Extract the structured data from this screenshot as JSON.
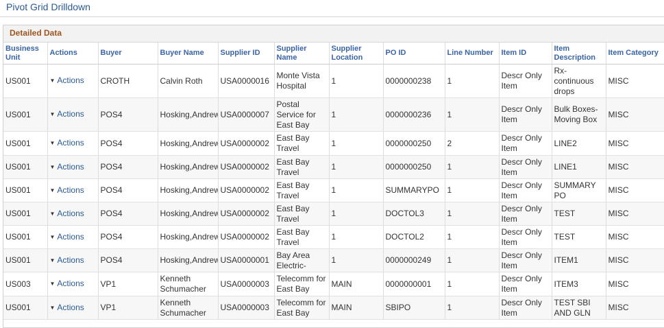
{
  "page": {
    "title": "Pivot Grid Drilldown"
  },
  "panel": {
    "title": "Detailed Data"
  },
  "columns": [
    "Business Unit",
    "Actions",
    "Buyer",
    "Buyer Name",
    "Supplier ID",
    "Supplier Name",
    "Supplier Location",
    "PO ID",
    "Line Number",
    "Item ID",
    "Item Description",
    "Item Category"
  ],
  "rows": [
    {
      "bu": "US001",
      "actions": "Actions",
      "buyer": "CROTH",
      "buyer_name": "Calvin Roth",
      "supplier_id": "USA0000016",
      "supplier_name": "Monte Vista Hospital",
      "supplier_location": "1",
      "po_id": "0000000238",
      "line": "1",
      "item_id": "Descr Only Item",
      "item_desc": "Rx-continuous drops",
      "item_cat": "MISC"
    },
    {
      "bu": "US001",
      "actions": "Actions",
      "buyer": "POS4",
      "buyer_name": "Hosking,Andrew",
      "supplier_id": "USA0000007",
      "supplier_name": "Postal Service for East Bay",
      "supplier_location": "1",
      "po_id": "0000000236",
      "line": "1",
      "item_id": "Descr Only Item",
      "item_desc": "Bulk Boxes-Moving Box",
      "item_cat": "MISC"
    },
    {
      "bu": "US001",
      "actions": "Actions",
      "buyer": "POS4",
      "buyer_name": "Hosking,Andrew",
      "supplier_id": "USA0000002",
      "supplier_name": "East Bay Travel",
      "supplier_location": "1",
      "po_id": "0000000250",
      "line": "2",
      "item_id": "Descr Only Item",
      "item_desc": "LINE2",
      "item_cat": "MISC"
    },
    {
      "bu": "US001",
      "actions": "Actions",
      "buyer": "POS4",
      "buyer_name": "Hosking,Andrew",
      "supplier_id": "USA0000002",
      "supplier_name": "East Bay Travel",
      "supplier_location": "1",
      "po_id": "0000000250",
      "line": "1",
      "item_id": "Descr Only Item",
      "item_desc": "LINE1",
      "item_cat": "MISC"
    },
    {
      "bu": "US001",
      "actions": "Actions",
      "buyer": "POS4",
      "buyer_name": "Hosking,Andrew",
      "supplier_id": "USA0000002",
      "supplier_name": "East Bay Travel",
      "supplier_location": "1",
      "po_id": "SUMMARYPO",
      "line": "1",
      "item_id": "Descr Only Item",
      "item_desc": "SUMMARY PO",
      "item_cat": "MISC"
    },
    {
      "bu": "US001",
      "actions": "Actions",
      "buyer": "POS4",
      "buyer_name": "Hosking,Andrew",
      "supplier_id": "USA0000002",
      "supplier_name": "East Bay Travel",
      "supplier_location": "1",
      "po_id": "DOCTOL3",
      "line": "1",
      "item_id": "Descr Only Item",
      "item_desc": "TEST",
      "item_cat": "MISC"
    },
    {
      "bu": "US001",
      "actions": "Actions",
      "buyer": "POS4",
      "buyer_name": "Hosking,Andrew",
      "supplier_id": "USA0000002",
      "supplier_name": "East Bay Travel",
      "supplier_location": "1",
      "po_id": "DOCTOL2",
      "line": "1",
      "item_id": "Descr Only Item",
      "item_desc": "TEST",
      "item_cat": "MISC"
    },
    {
      "bu": "US001",
      "actions": "Actions",
      "buyer": "POS4",
      "buyer_name": "Hosking,Andrew",
      "supplier_id": "USA0000001",
      "supplier_name": "Bay Area Electric-",
      "supplier_location": "1",
      "po_id": "0000000249",
      "line": "1",
      "item_id": "Descr Only Item",
      "item_desc": "ITEM1",
      "item_cat": "MISC"
    },
    {
      "bu": "US003",
      "actions": "Actions",
      "buyer": "VP1",
      "buyer_name": "Kenneth Schumacher",
      "supplier_id": "USA0000003",
      "supplier_name": "Telecomm for East Bay",
      "supplier_location": "MAIN",
      "po_id": "0000000001",
      "line": "1",
      "item_id": "Descr Only Item",
      "item_desc": "ITEM3",
      "item_cat": "MISC"
    },
    {
      "bu": "US001",
      "actions": "Actions",
      "buyer": "VP1",
      "buyer_name": "Kenneth Schumacher",
      "supplier_id": "USA0000003",
      "supplier_name": "Telecomm for East Bay",
      "supplier_location": "MAIN",
      "po_id": "SBIPO",
      "line": "1",
      "item_id": "Descr Only Item",
      "item_desc": "TEST SBI AND GLN",
      "item_cat": "MISC"
    }
  ]
}
